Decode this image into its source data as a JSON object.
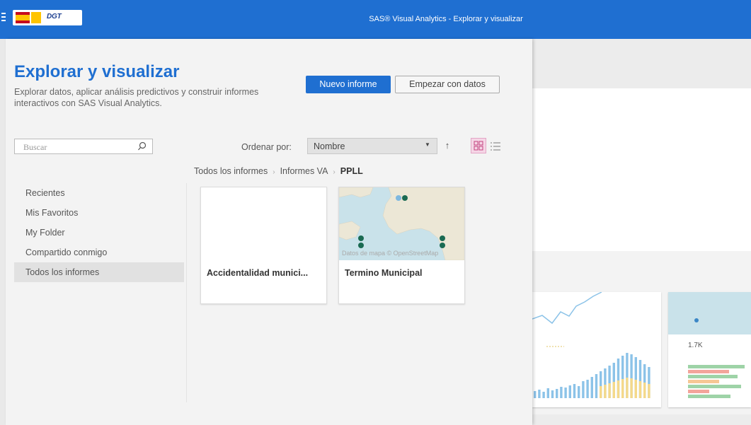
{
  "app": {
    "title": "SAS® Visual Analytics - Explorar y visualizar",
    "logo_dgt": "DGT"
  },
  "header": {
    "title": "Explorar y visualizar",
    "subtitle": "Explorar datos, aplicar análisis predictivos y construir informes interactivos con SAS Visual Analytics.",
    "new_report_label": "Nuevo informe",
    "start_with_data_label": "Empezar con datos"
  },
  "search": {
    "placeholder": "Buscar"
  },
  "sort": {
    "label": "Ordenar por:",
    "value": "Nombre"
  },
  "breadcrumb": {
    "items": [
      "Todos los informes",
      "Informes VA"
    ],
    "current": "PPLL"
  },
  "nav": {
    "items": [
      {
        "label": "Recientes"
      },
      {
        "label": "Mis Favoritos"
      },
      {
        "label": "My Folder"
      },
      {
        "label": "Compartido conmigo"
      },
      {
        "label": "Todos los informes",
        "active": true
      }
    ]
  },
  "reports": [
    {
      "name": "Accidentalidad munici..."
    },
    {
      "name": "Termino Municipal",
      "map_credit": "Datos de mapa © OpenStreetMap"
    }
  ],
  "background": {
    "metric": "1.7K"
  },
  "colors": {
    "accent": "#1f6fd1",
    "map_water": "#c9e2ea",
    "map_land": "#ece7d6",
    "marker": "#1a6a52"
  }
}
